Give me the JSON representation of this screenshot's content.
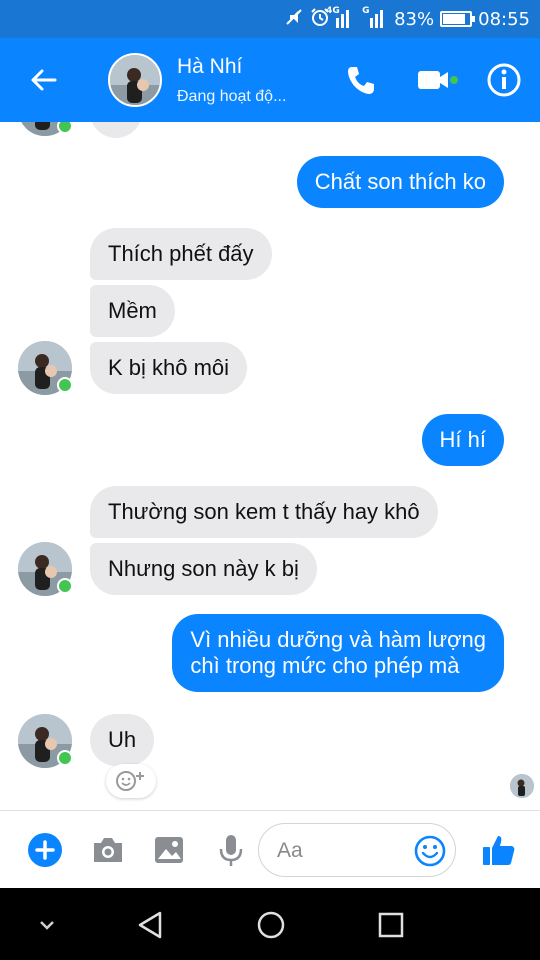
{
  "status_bar": {
    "network_4g": "4G",
    "network_g": "G",
    "battery": "83%",
    "battery_level": 0.83,
    "time": "08:55",
    "icons": [
      "mute-icon",
      "alarm-icon",
      "signal-icon",
      "signal-icon",
      "battery-icon"
    ]
  },
  "header": {
    "contact_name": "Hà Nhí",
    "status": "Đang hoạt độ...",
    "online_color": "#44c553",
    "background": "#0a84ff"
  },
  "messages": [
    {
      "side": "out",
      "text": "Chất son thích ko"
    },
    {
      "side": "in",
      "text": "Thích phết đấy"
    },
    {
      "side": "in",
      "text": "Mềm"
    },
    {
      "side": "in",
      "text": "K bị khô môi"
    },
    {
      "side": "out",
      "text": "Hí hí"
    },
    {
      "side": "in",
      "text": "Thường son kem t thấy hay khô"
    },
    {
      "side": "in",
      "text": "Nhưng son này k bị"
    },
    {
      "side": "out",
      "text": [
        "Vì nhiều dưỡng và hàm lượng",
        "chì trong mức cho phép mà"
      ]
    },
    {
      "side": "in",
      "text": "Uh"
    }
  ],
  "composer": {
    "placeholder": "Aa",
    "icons": [
      "plus-icon",
      "camera-icon",
      "image-icon",
      "microphone-icon",
      "emoji-icon",
      "thumbs-up-icon"
    ]
  },
  "colors": {
    "outgoing_bubble": "#0a84ff",
    "incoming_bubble": "#e9e9eb"
  }
}
